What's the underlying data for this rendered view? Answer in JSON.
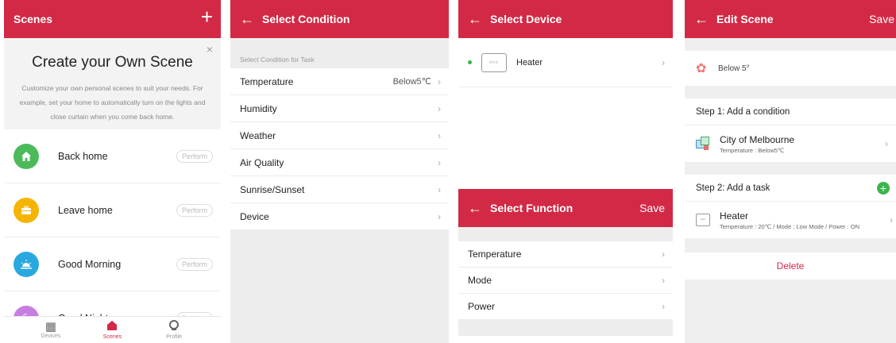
{
  "scenes_panel": {
    "title": "Scenes",
    "add_icon": "+",
    "banner": {
      "close_icon": "×",
      "heading": "Create your Own Scene",
      "description": "Customize your own personal scenes to suit your needs. For example, set your home to automatically turn on the lights and close curtain when you come back home."
    },
    "scenes": [
      {
        "name": "Back home",
        "action": "Perform",
        "icon": "home-icon",
        "color": "#4cba5a"
      },
      {
        "name": "Leave home",
        "action": "Perform",
        "icon": "briefcase-icon",
        "color": "#f5b400"
      },
      {
        "name": "Good Morning",
        "action": "Perform",
        "icon": "sunrise-icon",
        "color": "#29a8e0"
      },
      {
        "name": "Good Night",
        "action": "Perform",
        "icon": "moon-icon",
        "color": "#c77ee0"
      }
    ],
    "tabs": [
      {
        "label": "Devices",
        "icon": "grid-icon",
        "active": false
      },
      {
        "label": "Scenes",
        "icon": "house-icon",
        "active": true
      },
      {
        "label": "Profile",
        "icon": "user-icon",
        "active": false
      }
    ]
  },
  "condition_panel": {
    "title": "Select Condition",
    "section_label": "Select Condition for Task",
    "items": [
      {
        "label": "Temperature",
        "value": "Below5℃"
      },
      {
        "label": "Humidity",
        "value": ""
      },
      {
        "label": "Weather",
        "value": ""
      },
      {
        "label": "Air Quality",
        "value": ""
      },
      {
        "label": "Sunrise/Sunset",
        "value": ""
      },
      {
        "label": "Device",
        "value": ""
      }
    ]
  },
  "device_panel": {
    "title": "Select Device",
    "device": {
      "name": "Heater",
      "online_color": "#3bb54a"
    }
  },
  "function_panel": {
    "title": "Select Function",
    "save_label": "Save",
    "items": [
      {
        "label": "Temperature"
      },
      {
        "label": "Mode"
      },
      {
        "label": "Power"
      }
    ]
  },
  "edit_panel": {
    "title": "Edit Scene",
    "save_label": "Save",
    "scene_name": "Below 5°",
    "step1_label": "Step 1: Add a condition",
    "condition": {
      "title": "City of Melbourne",
      "detail": "Temperature : Below5℃"
    },
    "step2_label": "Step 2: Add a task",
    "add_icon": "+",
    "task": {
      "title": "Heater",
      "detail": "Temperature : 20℃ / Mode : Low Mode / Power : ON"
    },
    "delete_label": "Delete"
  },
  "colors": {
    "brand": "#d22a46",
    "online": "#3bb54a"
  }
}
